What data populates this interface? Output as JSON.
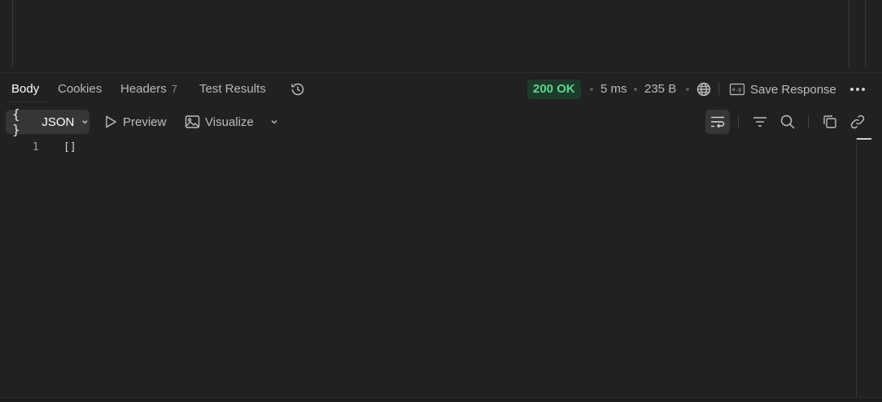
{
  "tabs": [
    {
      "label": "Body"
    },
    {
      "label": "Cookies"
    },
    {
      "label": "Headers",
      "count": "7"
    },
    {
      "label": "Test Results"
    }
  ],
  "status": {
    "code": "200 OK",
    "time": "5 ms",
    "size": "235 B",
    "save_label": "Save Response",
    "accent_color": "#5fd38f"
  },
  "toolbar": {
    "format_braces": "{ }",
    "format_label": "JSON",
    "preview_label": "Preview",
    "visualize_label": "Visualize"
  },
  "editor": {
    "lines": [
      {
        "number": "1",
        "text": "[]"
      }
    ]
  },
  "icons": {
    "history": "history-icon",
    "network": "globe-icon",
    "save": "save-response-icon",
    "more": "more-icon",
    "wrap": "wrap-lines-icon",
    "filter": "filter-icon",
    "search": "search-icon",
    "copy": "copy-icon",
    "link": "link-icon"
  }
}
